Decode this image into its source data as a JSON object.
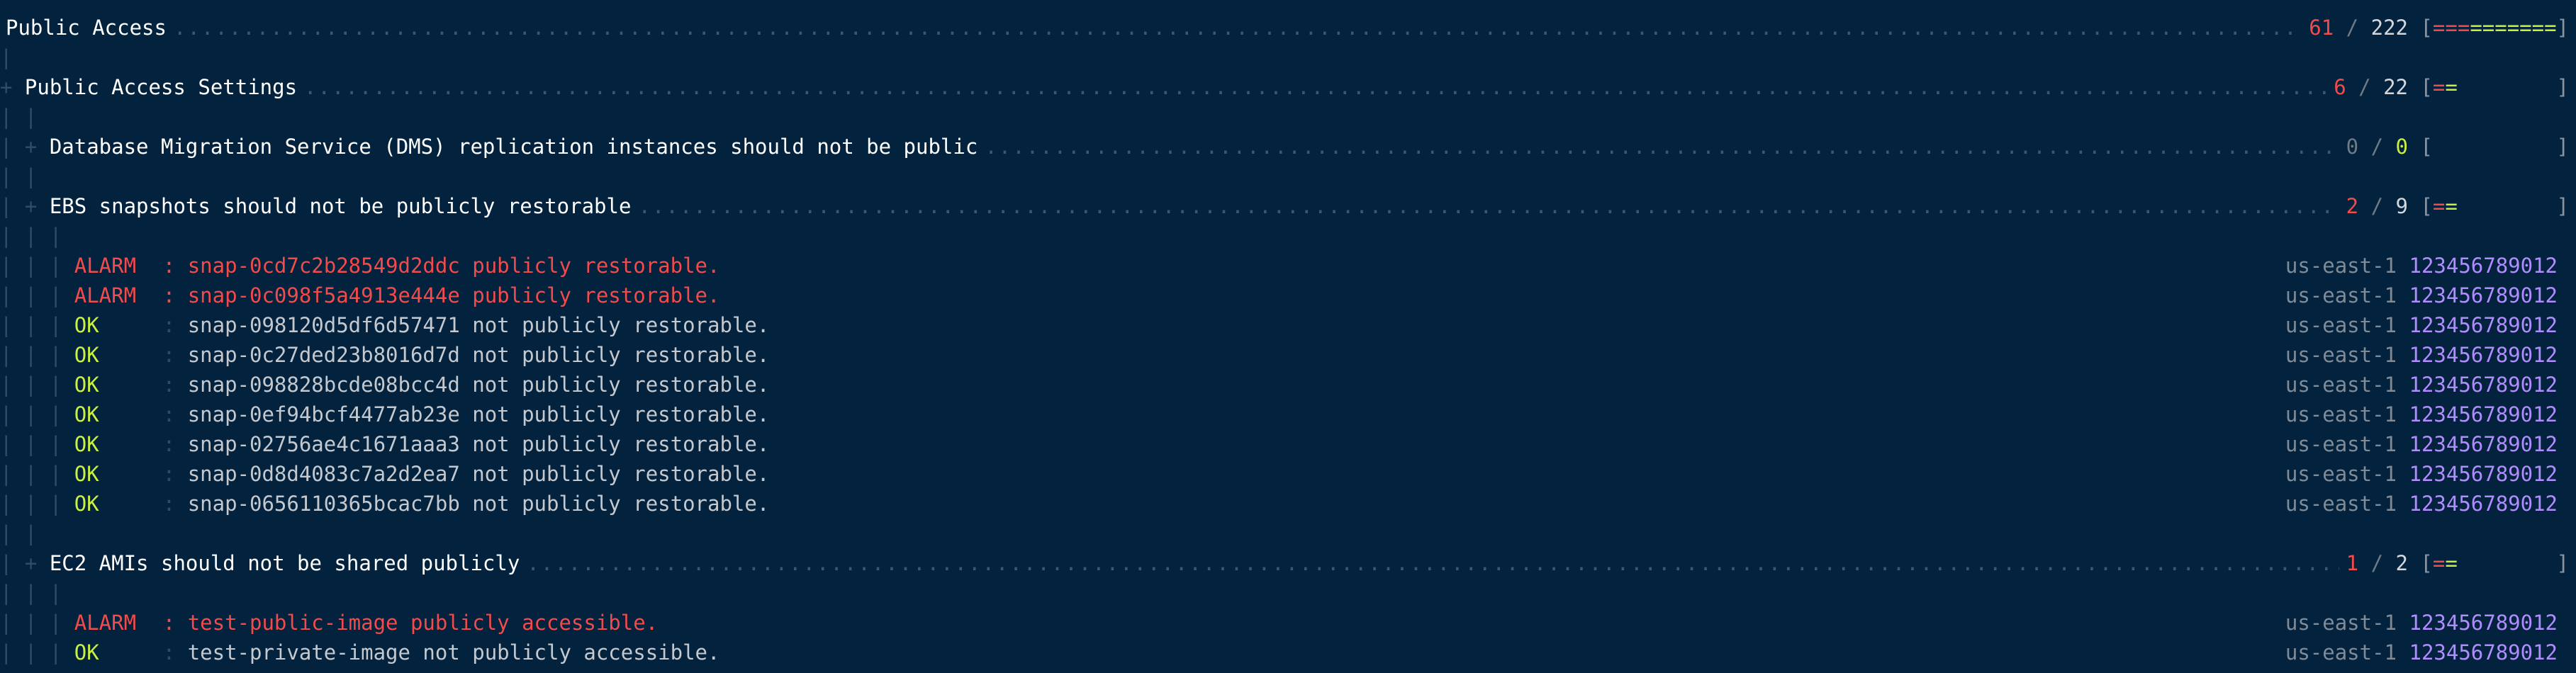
{
  "report": {
    "root": {
      "title": "Public Access",
      "alarm": "61",
      "total": "222",
      "bar_alarm": "===",
      "bar_ok": "=======",
      "bar_empty": ""
    },
    "group": {
      "title": "Public Access Settings",
      "alarm": "6",
      "total": "22",
      "bar_alarm": "=",
      "bar_ok": "=",
      "bar_empty": "        "
    },
    "controls": [
      {
        "title": "Database Migration Service (DMS) replication instances should not be public",
        "alarm": "0",
        "total": "0",
        "bar_alarm": "",
        "bar_ok": "",
        "bar_empty": "          ",
        "results": []
      },
      {
        "title": "EBS snapshots should not be publicly restorable",
        "alarm": "2",
        "total": "9",
        "bar_alarm": "=",
        "bar_ok": "=",
        "bar_empty": "        ",
        "results": [
          {
            "status": "ALARM",
            "reason": "snap-0cd7c2b28549d2ddc publicly restorable.",
            "region": "us-east-1",
            "account": "123456789012"
          },
          {
            "status": "ALARM",
            "reason": "snap-0c098f5a4913e444e publicly restorable.",
            "region": "us-east-1",
            "account": "123456789012"
          },
          {
            "status": "OK",
            "reason": "snap-098120d5df6d57471 not publicly restorable.",
            "region": "us-east-1",
            "account": "123456789012"
          },
          {
            "status": "OK",
            "reason": "snap-0c27ded23b8016d7d not publicly restorable.",
            "region": "us-east-1",
            "account": "123456789012"
          },
          {
            "status": "OK",
            "reason": "snap-098828bcde08bcc4d not publicly restorable.",
            "region": "us-east-1",
            "account": "123456789012"
          },
          {
            "status": "OK",
            "reason": "snap-0ef94bcf4477ab23e not publicly restorable.",
            "region": "us-east-1",
            "account": "123456789012"
          },
          {
            "status": "OK",
            "reason": "snap-02756ae4c1671aaa3 not publicly restorable.",
            "region": "us-east-1",
            "account": "123456789012"
          },
          {
            "status": "OK",
            "reason": "snap-0d8d4083c7a2d2ea7 not publicly restorable.",
            "region": "us-east-1",
            "account": "123456789012"
          },
          {
            "status": "OK",
            "reason": "snap-0656110365bcac7bb not publicly restorable.",
            "region": "us-east-1",
            "account": "123456789012"
          }
        ]
      },
      {
        "title": "EC2 AMIs should not be shared publicly",
        "alarm": "1",
        "total": "2",
        "bar_alarm": "=",
        "bar_ok": "=",
        "bar_empty": "        ",
        "results": [
          {
            "status": "ALARM",
            "reason": "test-public-image publicly accessible.",
            "region": "us-east-1",
            "account": "123456789012"
          },
          {
            "status": "OK",
            "reason": "test-private-image not publicly accessible.",
            "region": "us-east-1",
            "account": "123456789012"
          }
        ]
      }
    ]
  },
  "colors": {
    "background": "#03223d",
    "alarm": "#f14b4b",
    "ok": "#c9f041",
    "account": "#b18cff",
    "muted": "#7f8b96"
  },
  "glyphs": {
    "pipe": "|",
    "plus": "+",
    "slash": "/",
    "open_bracket": "[",
    "close_bracket": "]",
    "colon": ":"
  }
}
